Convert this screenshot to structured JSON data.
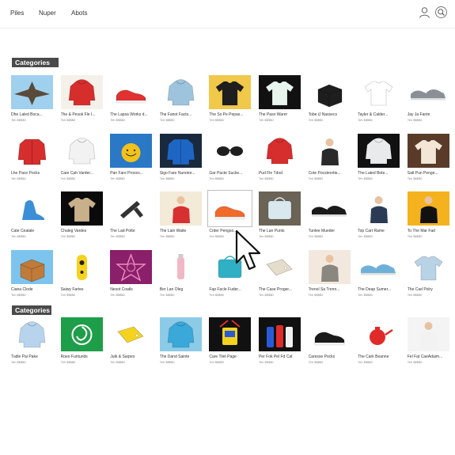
{
  "nav": {
    "links": [
      "Piles",
      "Nuper",
      "Abots"
    ]
  },
  "header_icons": [
    "user-icon",
    "search-icon"
  ],
  "sections": [
    {
      "title": "Categories"
    },
    {
      "title": "Categories"
    }
  ],
  "products": [
    {
      "title": "Dhe Laled Boca...",
      "price": "Teh $$$$0",
      "bg": "#9fd0ee",
      "kind": "wing",
      "color": "#5a4a3a",
      "icon": "gadget-icon"
    },
    {
      "title": "The & Pesok Fle I...",
      "price": "Teh $$$$0",
      "bg": "#f4f1ea",
      "kind": "hoodie",
      "color": "#d62d2d",
      "icon": "hoodie-icon"
    },
    {
      "title": "The Lapsa Works d...",
      "price": "Teh $$$$0",
      "bg": "#ffffff",
      "kind": "shoe",
      "color": "#e23131",
      "icon": "shoe-icon"
    },
    {
      "title": "The Fanot Facts...",
      "price": "Teh $$$$0",
      "bg": "#ffffff",
      "kind": "hoodie",
      "color": "#9ec3dc",
      "icon": "hoodie-icon"
    },
    {
      "title": "The Ss Pe Pepas...",
      "price": "Teh $$$$0",
      "bg": "#f0c84a",
      "kind": "tshirt",
      "color": "#1e1e1e",
      "icon": "tshirt-icon"
    },
    {
      "title": "The Paso Warer",
      "price": "Teh $$$$0",
      "bg": "#111111",
      "kind": "tshirt",
      "color": "#e8f4ee",
      "icon": "tshirt-icon"
    },
    {
      "title": "Tobe.iJ Nassecs",
      "price": "Teh $$$$0",
      "bg": "#ffffff",
      "kind": "box",
      "color": "#1e1e1e",
      "icon": "box-icon"
    },
    {
      "title": "Tayler & Calder...",
      "price": "Teh $$$$0",
      "bg": "#ffffff",
      "kind": "tshirt",
      "color": "#ffffff",
      "icon": "tshirt-icon"
    },
    {
      "title": "Jay Ja Fante",
      "price": "Teh $$$$0",
      "bg": "#ffffff",
      "kind": "sneakers",
      "color": "#8a8f96",
      "icon": "sneakers-icon"
    },
    {
      "title": "Lhe Pace Pocks",
      "price": "Teh $$$$0",
      "bg": "#ffffff",
      "kind": "jacket",
      "color": "#d62d2d",
      "icon": "jacket-icon"
    },
    {
      "title": "Care Cah Varder...",
      "price": "Teh $$$$0",
      "bg": "#ffffff",
      "kind": "hoodie",
      "color": "#f2f2f2",
      "icon": "hoodie-icon"
    },
    {
      "title": "Pan Fare Proces...",
      "price": "Teh $$$$0",
      "bg": "#2a78c6",
      "kind": "ball",
      "color": "#f2c21b",
      "icon": "toy-icon"
    },
    {
      "title": "Sigo Fare Nunotor...",
      "price": "Teh $$$$0",
      "bg": "#1a2a3e",
      "kind": "jacket",
      "color": "#1e66c4",
      "icon": "jacket-icon"
    },
    {
      "title": "Gar Pacte Sucke...",
      "price": "Teh $$$$0",
      "bg": "#ffffff",
      "kind": "glasses",
      "color": "#1e1e1e",
      "icon": "sunglasses-icon"
    },
    {
      "title": "Pud Fle Tdod",
      "price": "Teh $$$$0",
      "bg": "#ffffff",
      "kind": "hoodie",
      "color": "#d62d2d",
      "icon": "hoodie-icon"
    },
    {
      "title": "Cote Pocsteortie...",
      "price": "Teh $$$$0",
      "bg": "#ffffff",
      "kind": "person",
      "color": "#2a2a2a",
      "icon": "person-icon"
    },
    {
      "title": "The Lated Bote...",
      "price": "Teh $$$$0",
      "bg": "#111111",
      "kind": "hoodie",
      "color": "#e8eaec",
      "icon": "hoodie-icon"
    },
    {
      "title": "Salt Pun Penge...",
      "price": "Teh $$$$0",
      "bg": "#5a3b2a",
      "kind": "tshirt",
      "color": "#f3e6d6",
      "icon": "tshirt-icon"
    },
    {
      "title": "Cate Ceatale",
      "price": "Teh $$$$0",
      "bg": "#ffffff",
      "kind": "heel",
      "color": "#3a8fd6",
      "icon": "heel-icon"
    },
    {
      "title": "Chaleg Vardes",
      "price": "Teh $$$$0",
      "bg": "#0a0a0a",
      "kind": "tshirt",
      "color": "#c8b08a",
      "icon": "tshirt-icon"
    },
    {
      "title": "The Lad Potte",
      "price": "Teh $$$$0",
      "bg": "#ffffff",
      "kind": "tool",
      "color": "#333333",
      "icon": "tool-icon"
    },
    {
      "title": "The Lain Waite",
      "price": "Teh $$$$0",
      "bg": "#f3ead8",
      "kind": "person",
      "color": "#d63030",
      "icon": "person-icon"
    },
    {
      "title": "Crder Pengso...",
      "price": "Teh $$$$0",
      "bg": "#ffffff",
      "kind": "shoe",
      "color": "#f26a2a",
      "icon": "shoe-icon",
      "selected": true
    },
    {
      "title": "The Lan Punts",
      "price": "Teh $$$$0",
      "bg": "#6a6356",
      "kind": "bag",
      "color": "#d9e8ee",
      "icon": "bag-icon"
    },
    {
      "title": "Tunlee Mueder",
      "price": "Teh $$$$0",
      "bg": "#ffffff",
      "kind": "sneakers",
      "color": "#1a1a1a",
      "icon": "sneakers-icon"
    },
    {
      "title": "Top Cart Rame",
      "price": "Teh $$$$0",
      "bg": "#ffffff",
      "kind": "person",
      "color": "#2b3b56",
      "icon": "person-icon"
    },
    {
      "title": "To The Mar Fad",
      "price": "Teh $$$$0",
      "bg": "#f4b21e",
      "kind": "person",
      "color": "#111111",
      "icon": "person-icon"
    },
    {
      "title": "Ciana Clode",
      "price": "Teh $$$$0",
      "bg": "#7cc4ee",
      "kind": "box",
      "color": "#c07a3a",
      "icon": "box-icon"
    },
    {
      "title": "Saiwy Fartes",
      "price": "Teh $$$$0",
      "bg": "#ffffff",
      "kind": "speaker",
      "color": "#f4d21e",
      "icon": "speaker-icon"
    },
    {
      "title": "Nesot Coatls",
      "price": "Teh $$$$0",
      "bg": "#8a1f6a",
      "kind": "star",
      "color": "#f08ac0",
      "icon": "logo-icon"
    },
    {
      "title": "Ber Lan Oleg",
      "price": "Teh $$$$0",
      "bg": "#ffffff",
      "kind": "bottle",
      "color": "#f0b8c4",
      "icon": "bottle-icon"
    },
    {
      "title": "Fap Facle Fuder...",
      "price": "Teh $$$$0",
      "bg": "#ffffff",
      "kind": "bag",
      "color": "#2fb0c4",
      "icon": "bag-icon"
    },
    {
      "title": "The Case Proger...",
      "price": "Teh $$$$0",
      "bg": "#ffffff",
      "kind": "tag",
      "color": "#e6dccb",
      "icon": "tag-icon"
    },
    {
      "title": "Trenol Sa Trenn...",
      "price": "Teh $$$$0",
      "bg": "#f2e8de",
      "kind": "person",
      "color": "#8a8680",
      "icon": "person-icon"
    },
    {
      "title": "The Deap Sumer...",
      "price": "Teh $$$$0",
      "bg": "#ffffff",
      "kind": "sneakers",
      "color": "#6fb0d8",
      "icon": "sneakers-icon"
    },
    {
      "title": "The Cad Polry",
      "price": "Teh $$$$0",
      "bg": "#ffffff",
      "kind": "tshirt",
      "color": "#b8d2e6",
      "icon": "tshirt-icon"
    },
    {
      "title": "Tudle Pai Pake",
      "price": "Teh $$$$0",
      "bg": "#ffffff",
      "kind": "hoodie",
      "color": "#b8d4ec",
      "icon": "hoodie-icon"
    },
    {
      "title": "Roeo Funtunds",
      "price": "Teh $$$$0",
      "bg": "#1f9e4a",
      "kind": "spiral",
      "color": "#ffffff",
      "icon": "logo-icon"
    },
    {
      "title": "Jutk & Sarpes",
      "price": "Teh $$$$0",
      "bg": "#ffffff",
      "kind": "tag",
      "color": "#f4d21e",
      "icon": "tag-icon"
    },
    {
      "title": "The Dand Sainte",
      "price": "Teh $$$$0",
      "bg": "#8ccbe8",
      "kind": "hoodie",
      "color": "#3aa8d8",
      "icon": "hoodie-icon"
    },
    {
      "title": "Care Tilet Page",
      "price": "Teh $$$$0",
      "bg": "#111111",
      "kind": "robot",
      "color": "#f4d21e",
      "icon": "toy-icon"
    },
    {
      "title": "Per Fok Pel Fd Cat",
      "price": "Teh $$$$0",
      "bg": "#111111",
      "kind": "bottles",
      "color": "#e02a2a",
      "icon": "bottle-icon"
    },
    {
      "title": "Caresse Pocks",
      "price": "Teh $$$$0",
      "bg": "#ffffff",
      "kind": "shoe",
      "color": "#1a1a1a",
      "icon": "shoe-icon"
    },
    {
      "title": "The Cark Beanne",
      "price": "Teh $$$$0",
      "bg": "#ffffff",
      "kind": "teapot",
      "color": "#e02a2a",
      "icon": "teapot-icon"
    },
    {
      "title": "Fel Fat CaeAdaim...",
      "price": "Teh $$$$0",
      "bg": "#f4f4f4",
      "kind": "person",
      "color": "#f2f2f2",
      "icon": "person-icon"
    }
  ]
}
